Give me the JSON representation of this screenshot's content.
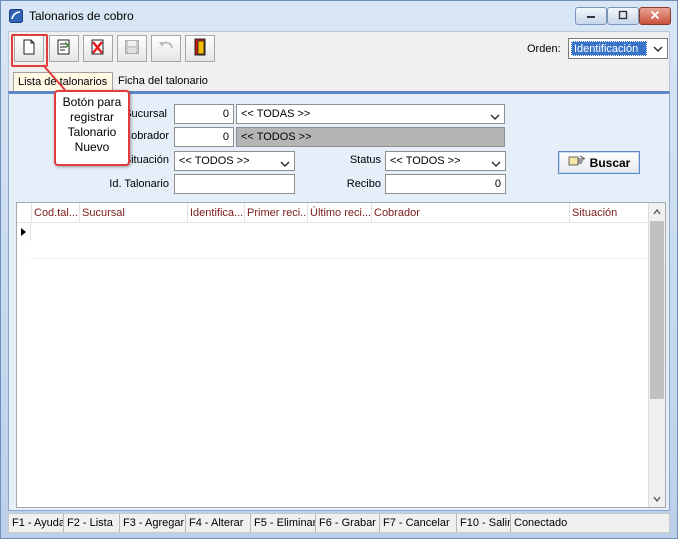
{
  "window": {
    "title": "Talonarios de cobro"
  },
  "toolbar": {
    "orden_label": "Orden:",
    "orden_value": "Identificación"
  },
  "tabs": [
    {
      "label": "Lista de talonarios"
    },
    {
      "label": "Ficha del talonario"
    }
  ],
  "filters": {
    "sucursal_label": "Sucursal",
    "sucursal_id": "0",
    "sucursal_name": "<< TODAS >>",
    "cobrador_label": "Cobrador",
    "cobrador_id": "0",
    "cobrador_name": "<< TODOS >>",
    "situacion_label": "Situación",
    "situacion_value": "<< TODOS >>",
    "status_label": "Status",
    "status_value": "<< TODOS >>",
    "id_talonario_label": "Id. Talonario",
    "id_talonario_value": "",
    "recibo_label": "Recibo",
    "recibo_value": "0",
    "buscar_label": "Buscar"
  },
  "grid": {
    "columns": [
      "Cod.tal...",
      "Sucursal",
      "Identifica...",
      "Primer reci...",
      "Último reci...",
      "Cobrador",
      "Situación"
    ]
  },
  "statusbar": {
    "items": [
      "F1 - Ayuda",
      "F2 - Lista",
      "F3 - Agregar",
      "F4 - Alterar",
      "F5 - Eliminar",
      "F6 - Grabar",
      "F7 - Cancelar",
      "F10 - Salir",
      "Conectado"
    ]
  },
  "callout": {
    "line1": "Botón para",
    "line2": "registrar",
    "line3": "Talonario",
    "line4": "Nuevo"
  },
  "colors": {
    "accent": "#3a74c9",
    "callout_border": "#e23b3b",
    "header_text": "#7a1a1a"
  }
}
